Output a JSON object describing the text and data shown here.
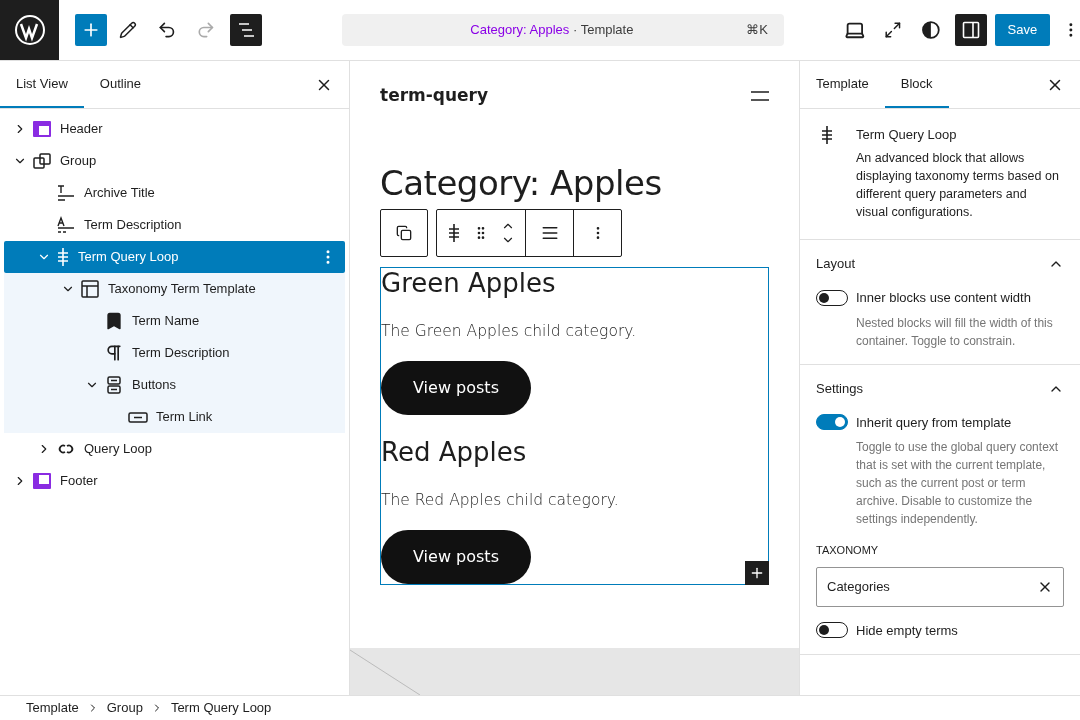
{
  "top_bar": {
    "command": {
      "title": "Category: Apples",
      "type": " · Template",
      "shortcut": "⌘K"
    },
    "save": "Save"
  },
  "left_panel": {
    "tabs": [
      {
        "label": "List View",
        "selected": true
      },
      {
        "label": "Outline",
        "selected": false
      }
    ],
    "tree": [
      {
        "kind": "header",
        "label": "Header",
        "expanded": false,
        "selected": false
      },
      {
        "kind": "group",
        "label": "Group",
        "expanded": true,
        "selected": false,
        "children": [
          {
            "kind": "title",
            "label": "Archive Title",
            "selected": false
          },
          {
            "kind": "description",
            "label": "Term Description",
            "selected": false
          },
          {
            "kind": "term-loop",
            "label": "Term Query Loop",
            "expanded": true,
            "selected": true,
            "children": [
              {
                "kind": "template",
                "label": "Taxonomy Term Template",
                "expanded": true,
                "selected": false,
                "children": [
                  {
                    "kind": "name",
                    "label": "Term Name",
                    "selected": false
                  },
                  {
                    "kind": "paragraph",
                    "label": "Term Description",
                    "selected": false
                  },
                  {
                    "kind": "buttons",
                    "label": "Buttons",
                    "expanded": true,
                    "selected": false,
                    "children": [
                      {
                        "kind": "link",
                        "label": "Term Link",
                        "selected": false
                      }
                    ]
                  }
                ]
              }
            ]
          },
          {
            "kind": "query-loop",
            "label": "Query Loop",
            "expanded": false,
            "selected": false
          }
        ]
      },
      {
        "kind": "footer",
        "label": "Footer",
        "expanded": false,
        "selected": false
      }
    ]
  },
  "canvas": {
    "site_title": "term-query",
    "heading": "Category: Apples",
    "terms": [
      {
        "name": "Green Apples",
        "description": "The Green Apples child category.",
        "button": "View posts"
      },
      {
        "name": "Red Apples",
        "description": "The Red Apples child category.",
        "button": "View posts"
      }
    ]
  },
  "right_panel": {
    "tabs": [
      {
        "label": "Template",
        "selected": false
      },
      {
        "label": "Block",
        "selected": true
      }
    ],
    "block": {
      "name": "Term Query Loop",
      "description": "An advanced block that allows displaying taxonomy terms based on different query parameters and visual configurations."
    },
    "sections": [
      {
        "title": "Layout",
        "expanded": true,
        "controls": [
          {
            "kind": "toggle",
            "label": "Inner blocks use content width",
            "on": false,
            "help": "Nested blocks will fill the width of this container. Toggle to constrain."
          }
        ]
      },
      {
        "title": "Settings",
        "expanded": true,
        "controls": [
          {
            "kind": "toggle",
            "label": "Inherit query from template",
            "on": true,
            "help": "Toggle to use the global query context that is set with the current template, such as the current post or term archive. Disable to customize the settings independently."
          },
          {
            "kind": "select",
            "label": "TAXONOMY",
            "value": "Categories"
          },
          {
            "kind": "toggle",
            "label": "Hide empty terms",
            "on": false
          }
        ]
      }
    ]
  },
  "breadcrumb": [
    "Template",
    "Group",
    "Term Query Loop"
  ]
}
